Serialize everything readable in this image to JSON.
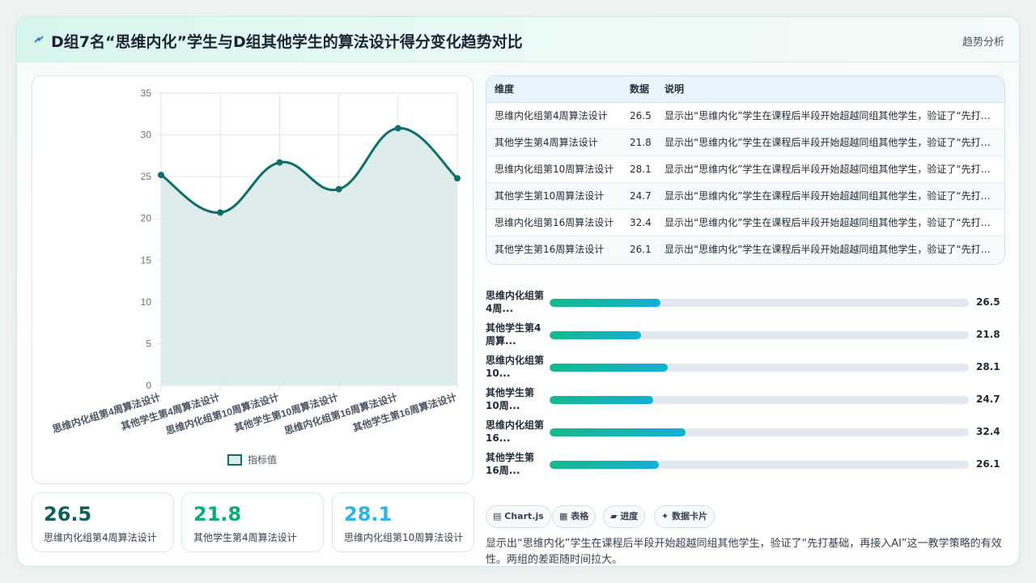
{
  "header": {
    "title": "D组7名“思维内化”学生与D组其他学生的算法设计得分变化趋势对比",
    "tag": "趋势分析",
    "icon": "lightning-icon"
  },
  "chart_data": {
    "type": "area",
    "categories": [
      "思维内化组第4周算法设计",
      "其他学生第4周算法设计",
      "思维内化组第10周算法设计",
      "其他学生第10周算法设计",
      "思维内化组第16周算法设计",
      "其他学生第16周算法设计"
    ],
    "series": [
      {
        "name": "指标值",
        "values": [
          25.2,
          20.7,
          26.7,
          23.5,
          30.8,
          24.8
        ]
      }
    ],
    "ylim": [
      0,
      35
    ],
    "yticks": [
      0,
      5,
      10,
      15,
      20,
      25,
      30,
      35
    ],
    "grid": true,
    "legend": "bottom",
    "colors": {
      "line": "#0f6e68",
      "fill": "#dcebea"
    }
  },
  "kpis": [
    {
      "value": "26.5",
      "label": "思维内化组第4周算法设计",
      "color": "#0f5e5a"
    },
    {
      "value": "21.8",
      "label": "其他学生第4周算法设计",
      "color": "#10a97a"
    },
    {
      "value": "28.1",
      "label": "思维内化组第10周算法设计",
      "color": "#2fb3e3"
    }
  ],
  "table": {
    "headers": [
      "维度",
      "数据",
      "说明"
    ],
    "rows": [
      [
        "思维内化组第4周算法设计",
        "26.5",
        "显示出“思维内化”学生在课程后半段开始超越同组其他学生，验证了“先打基础，再接入AI”这一教学策略的有效性。两组的差距随时间拉大。"
      ],
      [
        "其他学生第4周算法设计",
        "21.8",
        "显示出“思维内化”学生在课程后半段开始超越同组其他学生，验证了“先打基础，再接入AI”这一教学策略的有效性。两组的差距随时间拉大。"
      ],
      [
        "思维内化组第10周算法设计",
        "28.1",
        "显示出“思维内化”学生在课程后半段开始超越同组其他学生，验证了“先打基础，再接入AI”这一教学策略的有效性。两组的差距随时间拉大。"
      ],
      [
        "其他学生第10周算法设计",
        "24.7",
        "显示出“思维内化”学生在课程后半段开始超越同组其他学生，验证了“先打基础，再接入AI”这一教学策略的有效性。两组的差距随时间拉大。"
      ],
      [
        "思维内化组第16周算法设计",
        "32.4",
        "显示出“思维内化”学生在课程后半段开始超越同组其他学生，验证了“先打基础，再接入AI”这一教学策略的有效性。两组的差距随时间拉大。"
      ],
      [
        "其他学生第16周算法设计",
        "26.1",
        "显示出“思维内化”学生在课程后半段开始超越同组其他学生，验证了“先打基础，再接入AI”这一教学策略的有效性。两组的差距随时间拉大。"
      ]
    ]
  },
  "bars": {
    "max": 100,
    "items": [
      {
        "label": "思维内化组第4周...",
        "value": "26.5"
      },
      {
        "label": "其他学生第4周算...",
        "value": "21.8"
      },
      {
        "label": "思维内化组第10...",
        "value": "28.1"
      },
      {
        "label": "其他学生第10周...",
        "value": "24.7"
      },
      {
        "label": "思维内化组第16...",
        "value": "32.4"
      },
      {
        "label": "其他学生第16周...",
        "value": "26.1"
      }
    ]
  },
  "chips": [
    {
      "icon": "chart-icon",
      "glyph": "▤",
      "label": "Chart.js"
    },
    {
      "icon": "table-icon",
      "glyph": "▦",
      "label": "表格"
    },
    {
      "icon": "progress-icon",
      "glyph": "▰",
      "label": "进度"
    },
    {
      "icon": "card-icon",
      "glyph": "✦",
      "label": "数据卡片"
    }
  ],
  "summary": "显示出“思维内化”学生在课程后半段开始超越同组其他学生，验证了“先打基础，再接入AI”这一教学策略的有效性。两组的差距随时间拉大。"
}
